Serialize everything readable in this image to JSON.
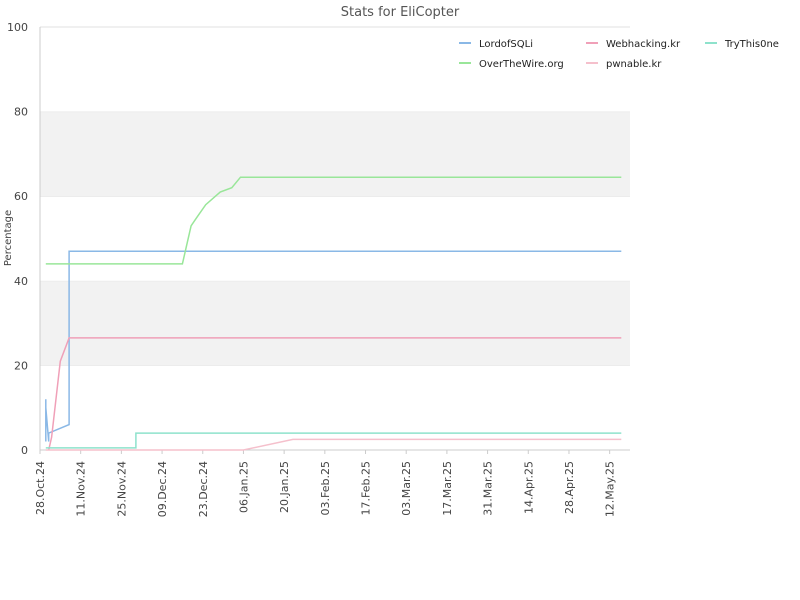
{
  "chart_data": {
    "type": "line",
    "title": "Stats for EliCopter",
    "xlabel": "",
    "ylabel": "Percentage",
    "ylim": [
      0,
      100
    ],
    "yticks": [
      0,
      20,
      40,
      60,
      80,
      100
    ],
    "xlim": [
      "2024-10-28",
      "2025-05-19"
    ],
    "xtick_labels": [
      "28.Oct.24",
      "11.Nov.24",
      "25.Nov.24",
      "09.Dec.24",
      "23.Dec.24",
      "06.Jan.25",
      "20.Jan.25",
      "03.Feb.25",
      "17.Feb.25",
      "03.Mar.25",
      "17.Mar.25",
      "31.Mar.25",
      "14.Apr.25",
      "28.Apr.25",
      "12.May.25"
    ],
    "xtick_dates": [
      "2024-10-28",
      "2024-11-11",
      "2024-11-25",
      "2024-12-09",
      "2024-12-23",
      "2025-01-06",
      "2025-01-20",
      "2025-02-03",
      "2025-02-17",
      "2025-03-03",
      "2025-03-17",
      "2025-03-31",
      "2025-04-14",
      "2025-04-28",
      "2025-05-12"
    ],
    "grid": "horizontal bands",
    "legend_position": "top-right",
    "series": [
      {
        "name": "LordofSQLi",
        "color": "#8ab8e6",
        "points": [
          [
            "2024-10-30",
            12
          ],
          [
            "2024-10-30",
            2
          ],
          [
            "2024-10-30",
            10
          ],
          [
            "2024-10-31",
            2
          ],
          [
            "2024-10-31",
            4
          ],
          [
            "2024-11-07",
            6
          ],
          [
            "2024-11-07",
            47
          ],
          [
            "2025-05-16",
            47
          ]
        ]
      },
      {
        "name": "OverTheWire.org",
        "color": "#99e699",
        "points": [
          [
            "2024-10-30",
            44
          ],
          [
            "2024-12-16",
            44
          ],
          [
            "2024-12-17",
            47
          ],
          [
            "2024-12-19",
            53
          ],
          [
            "2024-12-21",
            55
          ],
          [
            "2024-12-24",
            58
          ],
          [
            "2024-12-29",
            61
          ],
          [
            "2025-01-02",
            62
          ],
          [
            "2025-01-05",
            64.5
          ],
          [
            "2025-05-16",
            64.5
          ]
        ]
      },
      {
        "name": "Webhacking.kr",
        "color": "#f0a0b8",
        "points": [
          [
            "2024-10-31",
            0
          ],
          [
            "2024-11-01",
            3
          ],
          [
            "2024-11-04",
            21
          ],
          [
            "2024-11-07",
            26.5
          ],
          [
            "2025-05-16",
            26.5
          ]
        ]
      },
      {
        "name": "pwnable.kr",
        "color": "#f5c0cc",
        "points": [
          [
            "2024-10-30",
            0
          ],
          [
            "2025-01-06",
            0
          ],
          [
            "2025-01-23",
            2.5
          ],
          [
            "2025-05-16",
            2.5
          ]
        ]
      },
      {
        "name": "TryThis0ne",
        "color": "#8ee2cc",
        "points": [
          [
            "2024-10-30",
            0.5
          ],
          [
            "2024-11-30",
            0.5
          ],
          [
            "2024-11-30",
            4
          ],
          [
            "2025-05-16",
            4
          ]
        ]
      }
    ]
  }
}
